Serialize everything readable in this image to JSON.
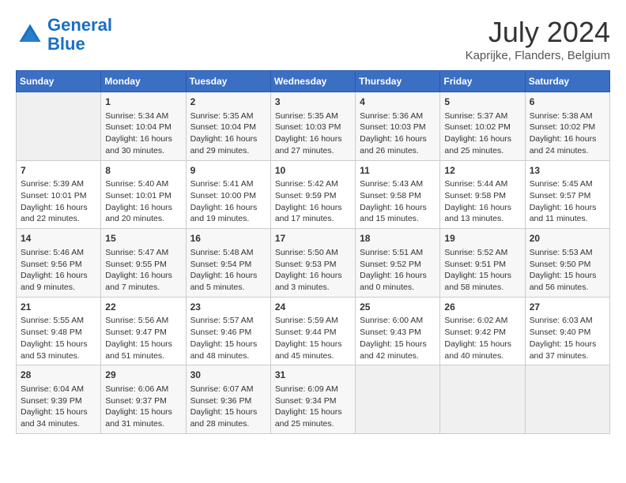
{
  "header": {
    "logo_line1": "General",
    "logo_line2": "Blue",
    "month_year": "July 2024",
    "location": "Kaprijke, Flanders, Belgium"
  },
  "days_of_week": [
    "Sunday",
    "Monday",
    "Tuesday",
    "Wednesday",
    "Thursday",
    "Friday",
    "Saturday"
  ],
  "weeks": [
    [
      {
        "day": "",
        "info": ""
      },
      {
        "day": "1",
        "info": "Sunrise: 5:34 AM\nSunset: 10:04 PM\nDaylight: 16 hours\nand 30 minutes."
      },
      {
        "day": "2",
        "info": "Sunrise: 5:35 AM\nSunset: 10:04 PM\nDaylight: 16 hours\nand 29 minutes."
      },
      {
        "day": "3",
        "info": "Sunrise: 5:35 AM\nSunset: 10:03 PM\nDaylight: 16 hours\nand 27 minutes."
      },
      {
        "day": "4",
        "info": "Sunrise: 5:36 AM\nSunset: 10:03 PM\nDaylight: 16 hours\nand 26 minutes."
      },
      {
        "day": "5",
        "info": "Sunrise: 5:37 AM\nSunset: 10:02 PM\nDaylight: 16 hours\nand 25 minutes."
      },
      {
        "day": "6",
        "info": "Sunrise: 5:38 AM\nSunset: 10:02 PM\nDaylight: 16 hours\nand 24 minutes."
      }
    ],
    [
      {
        "day": "7",
        "info": "Sunrise: 5:39 AM\nSunset: 10:01 PM\nDaylight: 16 hours\nand 22 minutes."
      },
      {
        "day": "8",
        "info": "Sunrise: 5:40 AM\nSunset: 10:01 PM\nDaylight: 16 hours\nand 20 minutes."
      },
      {
        "day": "9",
        "info": "Sunrise: 5:41 AM\nSunset: 10:00 PM\nDaylight: 16 hours\nand 19 minutes."
      },
      {
        "day": "10",
        "info": "Sunrise: 5:42 AM\nSunset: 9:59 PM\nDaylight: 16 hours\nand 17 minutes."
      },
      {
        "day": "11",
        "info": "Sunrise: 5:43 AM\nSunset: 9:58 PM\nDaylight: 16 hours\nand 15 minutes."
      },
      {
        "day": "12",
        "info": "Sunrise: 5:44 AM\nSunset: 9:58 PM\nDaylight: 16 hours\nand 13 minutes."
      },
      {
        "day": "13",
        "info": "Sunrise: 5:45 AM\nSunset: 9:57 PM\nDaylight: 16 hours\nand 11 minutes."
      }
    ],
    [
      {
        "day": "14",
        "info": "Sunrise: 5:46 AM\nSunset: 9:56 PM\nDaylight: 16 hours\nand 9 minutes."
      },
      {
        "day": "15",
        "info": "Sunrise: 5:47 AM\nSunset: 9:55 PM\nDaylight: 16 hours\nand 7 minutes."
      },
      {
        "day": "16",
        "info": "Sunrise: 5:48 AM\nSunset: 9:54 PM\nDaylight: 16 hours\nand 5 minutes."
      },
      {
        "day": "17",
        "info": "Sunrise: 5:50 AM\nSunset: 9:53 PM\nDaylight: 16 hours\nand 3 minutes."
      },
      {
        "day": "18",
        "info": "Sunrise: 5:51 AM\nSunset: 9:52 PM\nDaylight: 16 hours\nand 0 minutes."
      },
      {
        "day": "19",
        "info": "Sunrise: 5:52 AM\nSunset: 9:51 PM\nDaylight: 15 hours\nand 58 minutes."
      },
      {
        "day": "20",
        "info": "Sunrise: 5:53 AM\nSunset: 9:50 PM\nDaylight: 15 hours\nand 56 minutes."
      }
    ],
    [
      {
        "day": "21",
        "info": "Sunrise: 5:55 AM\nSunset: 9:48 PM\nDaylight: 15 hours\nand 53 minutes."
      },
      {
        "day": "22",
        "info": "Sunrise: 5:56 AM\nSunset: 9:47 PM\nDaylight: 15 hours\nand 51 minutes."
      },
      {
        "day": "23",
        "info": "Sunrise: 5:57 AM\nSunset: 9:46 PM\nDaylight: 15 hours\nand 48 minutes."
      },
      {
        "day": "24",
        "info": "Sunrise: 5:59 AM\nSunset: 9:44 PM\nDaylight: 15 hours\nand 45 minutes."
      },
      {
        "day": "25",
        "info": "Sunrise: 6:00 AM\nSunset: 9:43 PM\nDaylight: 15 hours\nand 42 minutes."
      },
      {
        "day": "26",
        "info": "Sunrise: 6:02 AM\nSunset: 9:42 PM\nDaylight: 15 hours\nand 40 minutes."
      },
      {
        "day": "27",
        "info": "Sunrise: 6:03 AM\nSunset: 9:40 PM\nDaylight: 15 hours\nand 37 minutes."
      }
    ],
    [
      {
        "day": "28",
        "info": "Sunrise: 6:04 AM\nSunset: 9:39 PM\nDaylight: 15 hours\nand 34 minutes."
      },
      {
        "day": "29",
        "info": "Sunrise: 6:06 AM\nSunset: 9:37 PM\nDaylight: 15 hours\nand 31 minutes."
      },
      {
        "day": "30",
        "info": "Sunrise: 6:07 AM\nSunset: 9:36 PM\nDaylight: 15 hours\nand 28 minutes."
      },
      {
        "day": "31",
        "info": "Sunrise: 6:09 AM\nSunset: 9:34 PM\nDaylight: 15 hours\nand 25 minutes."
      },
      {
        "day": "",
        "info": ""
      },
      {
        "day": "",
        "info": ""
      },
      {
        "day": "",
        "info": ""
      }
    ]
  ]
}
